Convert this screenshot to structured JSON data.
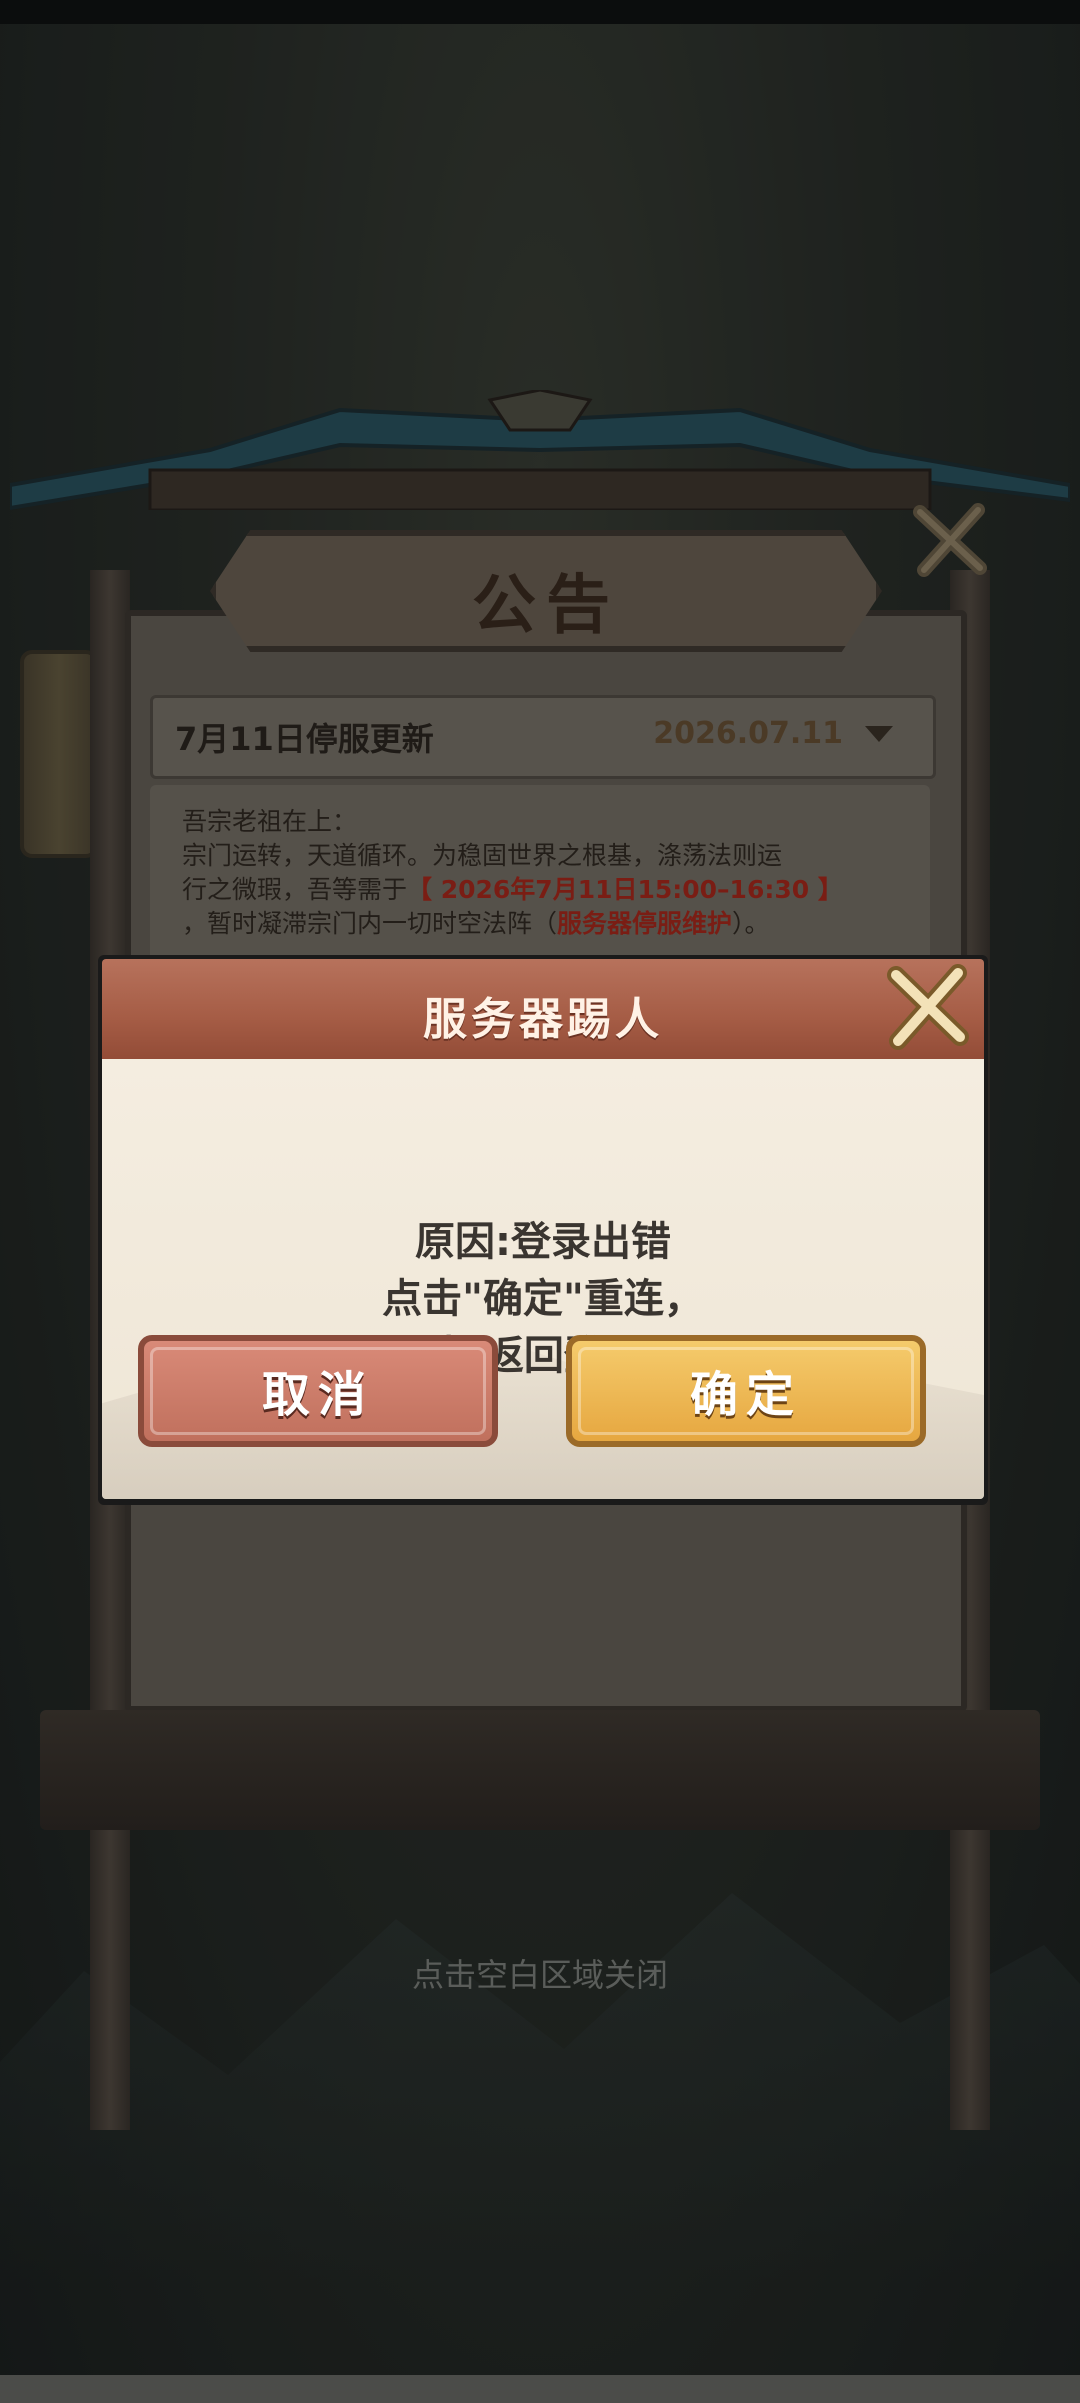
{
  "announcement": {
    "title": "公告",
    "header_title": "7月11日停服更新",
    "header_date": "2026.07.11",
    "body_line1": "吾宗老祖在上：",
    "body_line2": "宗门运转，天道循环。为稳固世界之根基，涤荡法则运",
    "body_line3_a": "行之微瑕，吾等需于",
    "body_line3_red": "【 2026年7月11日15:00–16:30 】",
    "body_line4_a": "，暂时凝滞宗门内一切时空法阵（",
    "body_line4_red": "服务器停服维护",
    "body_line4_b": "）。"
  },
  "dialog": {
    "title": "服务器踢人",
    "line1": "原因:登录出错",
    "line2": "点击\"确定\"重连，",
    "line3": "\"取消\"返回登录界面",
    "cancel_label": "取消",
    "confirm_label": "确定"
  },
  "hint": "点击空白区域关闭",
  "icons": {
    "announcement_close": "close-x-icon",
    "dialog_close": "close-x-icon",
    "header_dropdown": "caret-down-icon"
  },
  "colors": {
    "dialog_title_bar": "#a55c45",
    "cancel_button": "#c97a67",
    "confirm_button": "#eeb552",
    "notice_red": "#7a1d14"
  }
}
